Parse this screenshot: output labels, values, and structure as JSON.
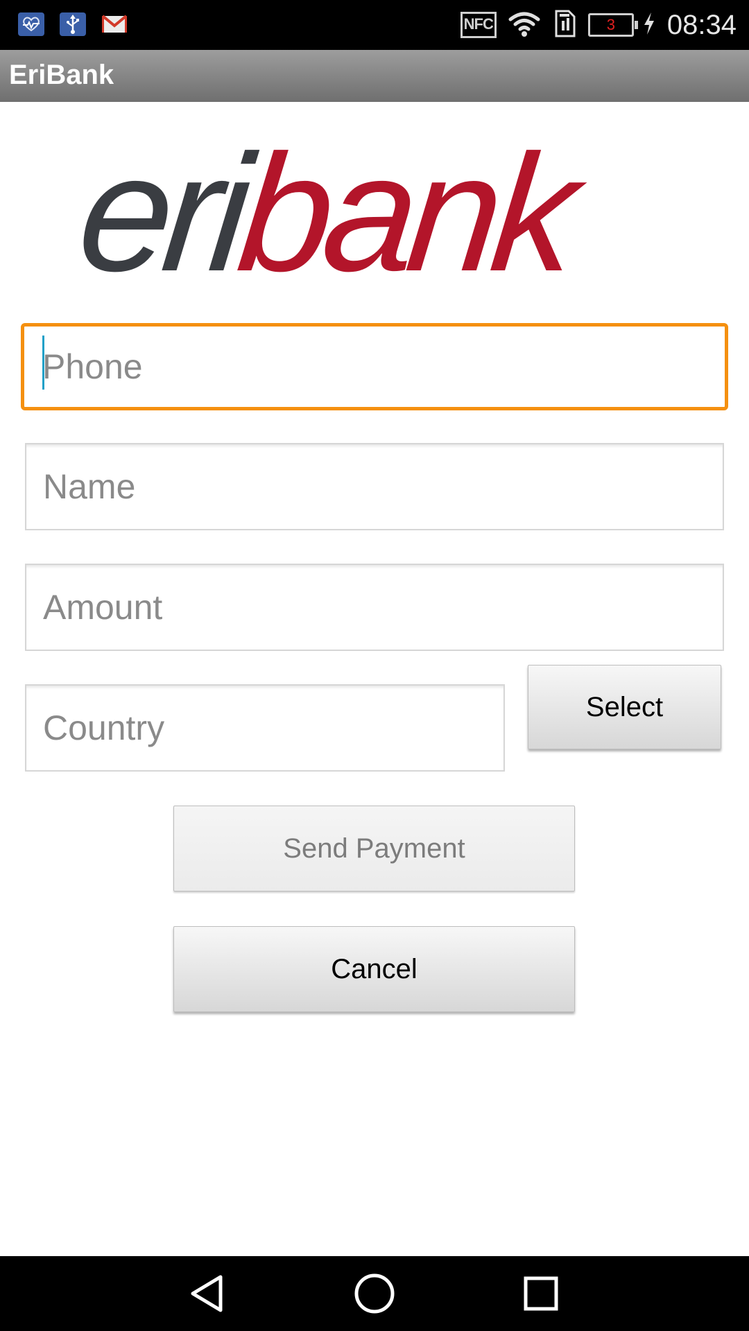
{
  "status_bar": {
    "notification_icons": [
      "health-icon",
      "usb-icon",
      "gmail-icon"
    ],
    "system_icons": [
      "nfc-icon",
      "wifi-icon",
      "sim-icon",
      "battery-icon",
      "charging-icon"
    ],
    "nfc_label": "NFC",
    "battery_level": "3",
    "time": "08:34"
  },
  "action_bar": {
    "title": "EriBank"
  },
  "logo": {
    "text_part1": "eri",
    "text_part2": "bank",
    "color_part1": "#3a3d42",
    "color_part2": "#b3152a"
  },
  "form": {
    "phone_placeholder": "Phone",
    "phone_value": "",
    "name_placeholder": "Name",
    "name_value": "",
    "amount_placeholder": "Amount",
    "amount_value": "",
    "country_placeholder": "Country",
    "country_value": "",
    "select_label": "Select",
    "send_payment_label": "Send Payment",
    "cancel_label": "Cancel"
  },
  "colors": {
    "focus_border": "#f5900f",
    "caret": "#1fa0c8",
    "status_bar_bg": "#000000",
    "action_bar_bg": "#8a8a8a"
  },
  "nav_bar": {
    "icons": [
      "back-icon",
      "home-icon",
      "recents-icon"
    ]
  }
}
